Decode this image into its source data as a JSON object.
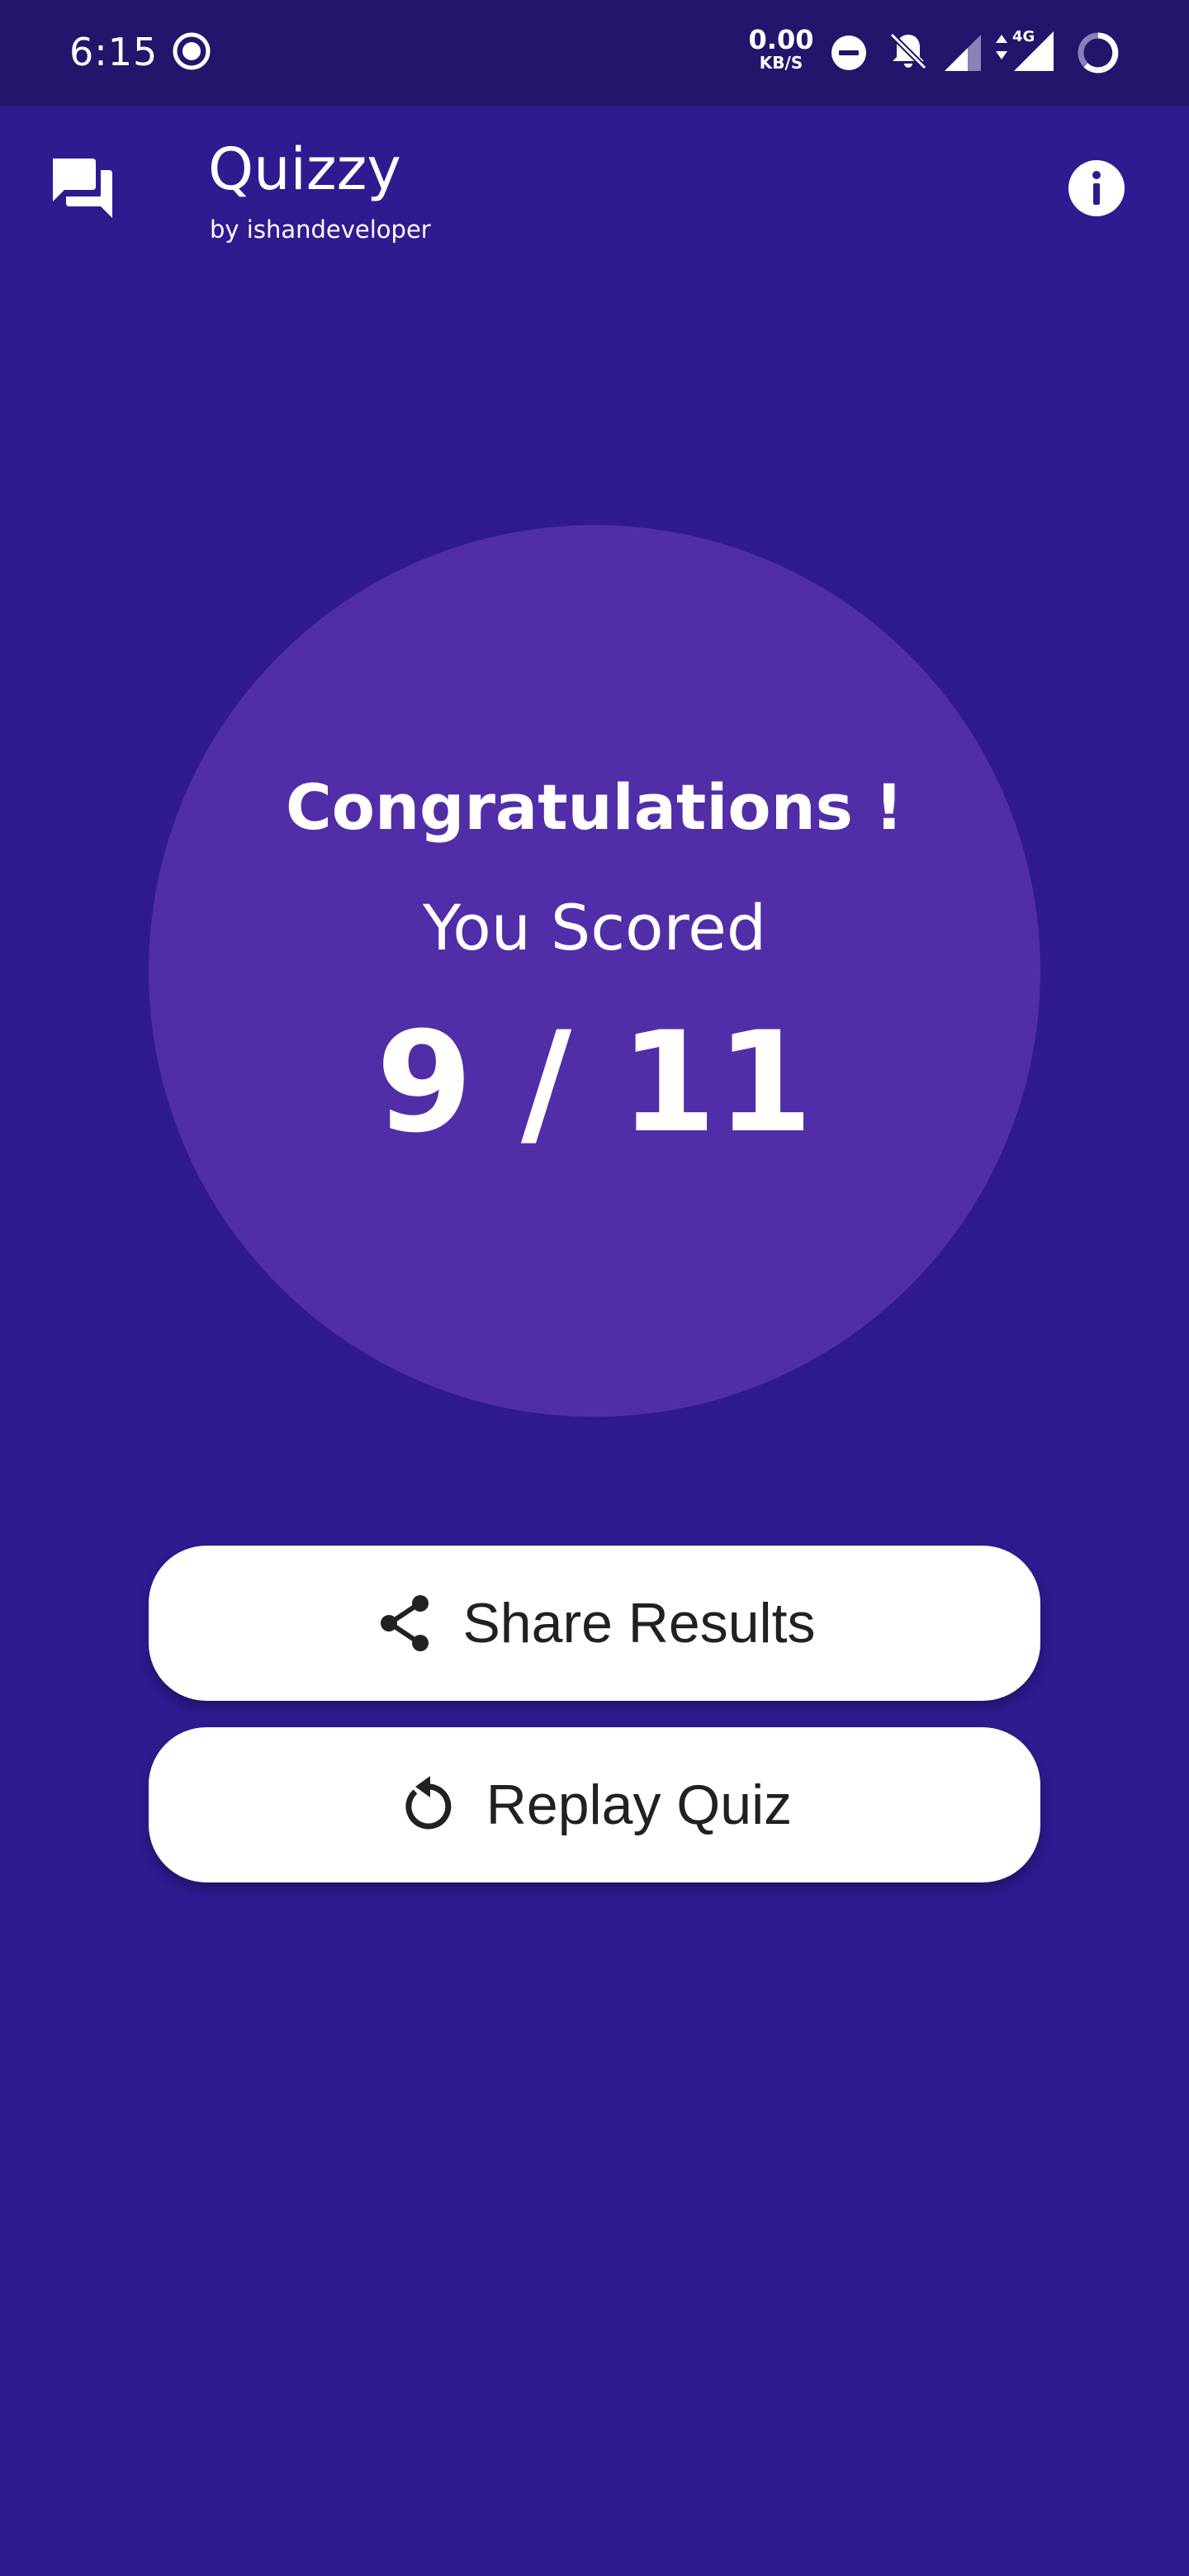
{
  "status_bar": {
    "time": "6:15",
    "net_speed_value": "0.00",
    "net_speed_unit": "KB/S",
    "network_type": "4G"
  },
  "app_bar": {
    "title": "Quizzy",
    "subtitle": "by ishandeveloper"
  },
  "result": {
    "headline": "Congratulations !",
    "scored_label": "You Scored",
    "score": "9 / 11"
  },
  "actions": {
    "share_label": "Share Results",
    "replay_label": "Replay Quiz"
  },
  "colors": {
    "background": "#2f1a90",
    "status_bar": "#23156b",
    "circle": "#512ea8",
    "button": "#ffffff",
    "button_text": "#212121"
  },
  "icons": {
    "appbar_left": "chat-bubbles-icon",
    "appbar_right": "info-icon",
    "share": "share-icon",
    "replay": "replay-icon"
  }
}
